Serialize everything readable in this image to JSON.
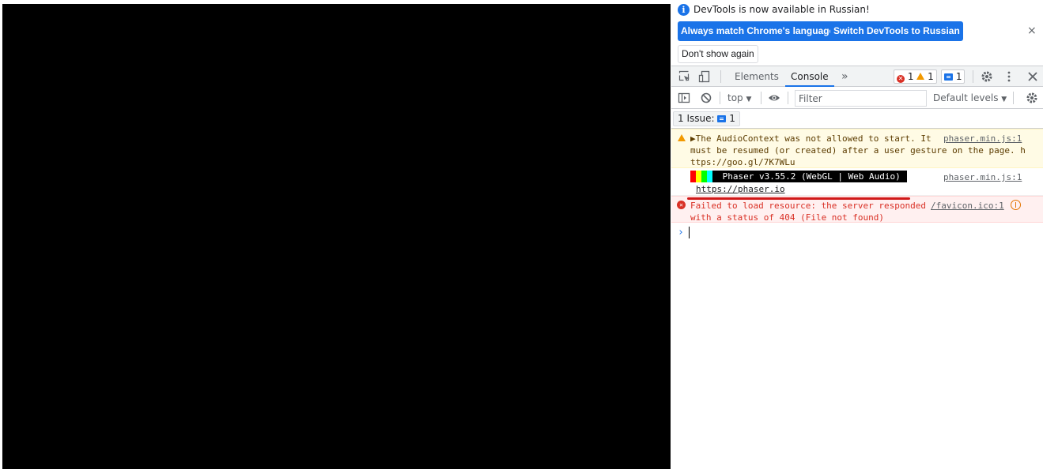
{
  "devtools": {
    "infobar": {
      "message": "DevTools is now available in Russian!",
      "btn_match": "Always match Chrome's language",
      "btn_switch": "Switch DevTools to Russian",
      "btn_dont_show": "Don't show again",
      "close": "×"
    },
    "tabs": {
      "elements": "Elements",
      "console": "Console",
      "more": "»",
      "error_count": "1",
      "warning_count": "1",
      "message_count": "1"
    },
    "console_toolbar": {
      "context": "top",
      "filter_placeholder": "Filter",
      "levels": "Default levels"
    },
    "issues": {
      "label": "1 Issue:",
      "count": "1"
    },
    "messages": [
      {
        "level": "warning",
        "text": "▶The AudioContext was not allowed to start. It\nmust be resumed (or created) after a user gesture on the page. h\nttps://goo.gl/7K7WLu",
        "source": "phaser.min.js:1"
      },
      {
        "level": "log",
        "banner": " Phaser v3.55.2 (WebGL | Web Audio)",
        "link": "https://phaser.io",
        "source": "phaser.min.js:1"
      },
      {
        "level": "error",
        "text": "Failed to load resource: the server responded\nwith a status of 404 (File not found)",
        "source": "/favicon.ico:1"
      }
    ],
    "prompt": "›"
  },
  "colors": {
    "accent": "#1a73e8",
    "error": "#d93025",
    "warning": "#f29900",
    "phaser_bars": [
      "#ff0000",
      "#ffff00",
      "#00ff00",
      "#00ffff"
    ]
  }
}
